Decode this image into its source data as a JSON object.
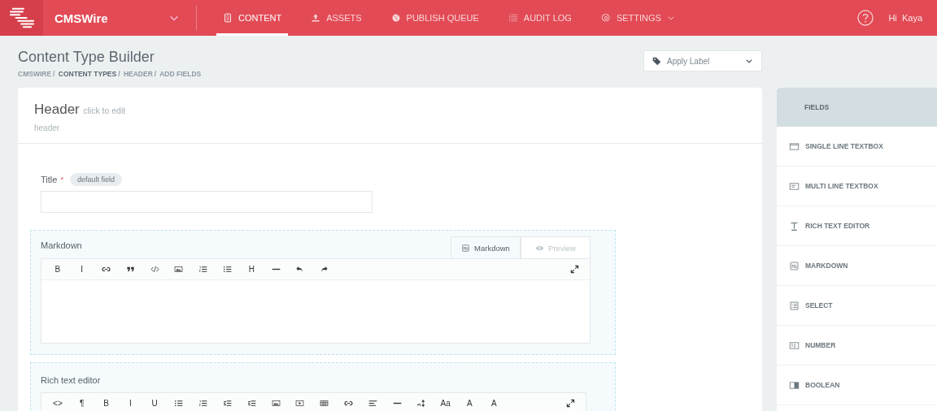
{
  "brand": {
    "name": "CMSWire"
  },
  "nav": [
    {
      "label": "CONTENT",
      "selected": true,
      "dropdown": false
    },
    {
      "label": "ASSETS",
      "selected": false,
      "dropdown": false
    },
    {
      "label": "PUBLISH QUEUE",
      "selected": false,
      "dropdown": false
    },
    {
      "label": "AUDIT LOG",
      "selected": false,
      "dropdown": false
    },
    {
      "label": "SETTINGS",
      "selected": false,
      "dropdown": true
    }
  ],
  "user": {
    "greeting": "Hi",
    "name": "Kaya"
  },
  "page": {
    "title": "Content Type Builder",
    "breadcrumb_separator": "/",
    "breadcrumb": [
      "CMSWIRE",
      "CONTENT TYPES",
      "HEADER",
      "ADD FIELDS"
    ]
  },
  "label_dropdown": {
    "placeholder": "Apply Label"
  },
  "content_type": {
    "name": "Header",
    "edit_hint": "click to edit",
    "uid": "header"
  },
  "title_field": {
    "label": "Title",
    "required_mark": "*",
    "badge": "default field"
  },
  "markdown_field": {
    "label": "Markdown",
    "tabs": [
      {
        "label": "Markdown",
        "selected": true
      },
      {
        "label": "Preview",
        "selected": false
      }
    ],
    "toolbar": [
      {
        "kind": "bold",
        "label": "B"
      },
      {
        "kind": "italic",
        "label": "I"
      },
      {
        "kind": "link"
      },
      {
        "kind": "quote"
      },
      {
        "kind": "code"
      },
      {
        "kind": "image"
      },
      {
        "kind": "ol"
      },
      {
        "kind": "ul"
      },
      {
        "kind": "heading",
        "label": "H"
      },
      {
        "kind": "hr"
      },
      {
        "kind": "undo"
      },
      {
        "kind": "redo"
      }
    ]
  },
  "rich_text_field": {
    "label": "Rich text editor",
    "toolbar": [
      {
        "kind": "source",
        "label": "<>"
      },
      {
        "kind": "paragraph",
        "label": "¶"
      },
      {
        "kind": "bold",
        "label": "B"
      },
      {
        "kind": "italic",
        "label": "I"
      },
      {
        "kind": "underline",
        "label": "U"
      },
      {
        "kind": "ul"
      },
      {
        "kind": "ol"
      },
      {
        "kind": "outdent"
      },
      {
        "kind": "indent"
      },
      {
        "kind": "image"
      },
      {
        "kind": "video"
      },
      {
        "kind": "table"
      },
      {
        "kind": "link"
      },
      {
        "kind": "align"
      },
      {
        "kind": "hr"
      },
      {
        "kind": "fontsize"
      },
      {
        "kind": "case",
        "label": "Aa"
      },
      {
        "kind": "color",
        "label": "A"
      },
      {
        "kind": "highlight",
        "label": "A"
      }
    ]
  },
  "sidebar": {
    "title": "FIELDS",
    "items": [
      {
        "label": "SINGLE LINE TEXTBOX"
      },
      {
        "label": "MULTI LINE TEXTBOX"
      },
      {
        "label": "RICH TEXT EDITOR"
      },
      {
        "label": "MARKDOWN"
      },
      {
        "label": "SELECT"
      },
      {
        "label": "NUMBER"
      },
      {
        "label": "BOOLEAN"
      }
    ]
  }
}
